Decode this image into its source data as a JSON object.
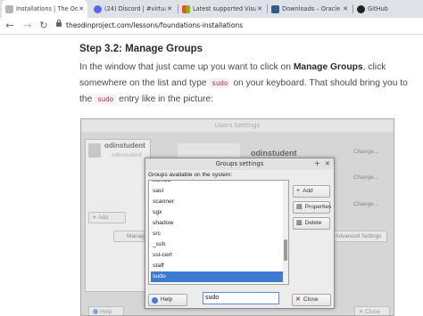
{
  "browser": {
    "tabs": [
      {
        "label": "Installations | The Odin",
        "active": true,
        "favicon_color": "#b5b5b5",
        "close": "✕"
      },
      {
        "label": "(24) Discord | #virtual",
        "active": false,
        "favicon_color": "#5865f2",
        "close": "✕"
      },
      {
        "label": "Latest supported Visu",
        "active": false,
        "favicon_color": "#0078d4",
        "close": "✕"
      },
      {
        "label": "Downloads – Oracle V",
        "active": false,
        "favicon_color": "#2f5e8e",
        "close": "✕"
      },
      {
        "label": "GitHub",
        "active": false,
        "favicon_color": "#222222",
        "close": ""
      }
    ],
    "nav": {
      "back": "←",
      "forward": "→",
      "reload": "↻"
    },
    "url": "theodinproject.com/lessons/foundations-installations"
  },
  "content": {
    "heading": "Step 3.2: Manage Groups",
    "line1_a": "In the window that just came up you want to click on ",
    "line1_b": "Manage Groups",
    "line1_c": ", click",
    "line2_a": "somewhere on the list and type ",
    "line2_code": "sudo",
    "line2_b": " on your keyboard. That should bring you to",
    "line3_a": "the ",
    "line3_code": "sudo",
    "line3_b": " entry like in the picture:"
  },
  "users_window": {
    "title": "Users Settings",
    "user_name": "odinstudent",
    "user_name_sub": "odinstudent",
    "right_name": "odinstudent",
    "change1": "Change...",
    "change2": "Change...",
    "change3": "Change...",
    "add_label": "Add",
    "manage_label": "Manag",
    "advanced_label": "Advanced Settings",
    "help_label": "Help",
    "close_label": "Close"
  },
  "groups_dialog": {
    "title": "Groups settings",
    "list_label": "Groups available on the system:",
    "groups": [
      "samba",
      "sasl",
      "scanner",
      "sgx",
      "shadow",
      "src",
      "_ssh",
      "ssl-cert",
      "staff",
      "sudo"
    ],
    "selected": "sudo",
    "add_label": "Add",
    "properties_label": "Properties",
    "delete_label": "Delete",
    "help_label": "Help",
    "close_label": "Close",
    "search_value": "sudo",
    "title_plus": "+",
    "title_close": "✕"
  }
}
